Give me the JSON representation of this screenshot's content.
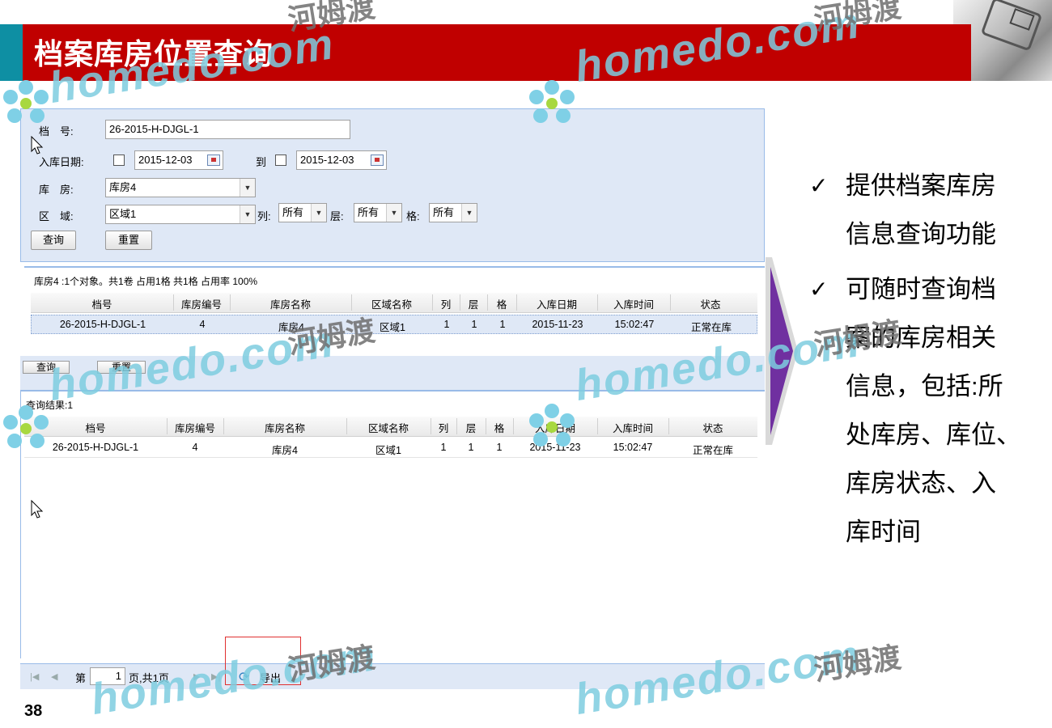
{
  "slide": {
    "title": "档案库房位置查询",
    "page_number": "38"
  },
  "query_form": {
    "archive_no_label": "档　号:",
    "archive_no_value": "26-2015-H-DJGL-1",
    "entry_date_label": "入库日期:",
    "date_from": "2015-12-03",
    "to_label": "到",
    "date_to": "2015-12-03",
    "warehouse_label": "库　房:",
    "warehouse_value": "库房4",
    "area_label": "区　域:",
    "area_value": "区域1",
    "column_label": "列:",
    "column_value": "所有",
    "layer_label": "层:",
    "layer_value": "所有",
    "cell_label": "格:",
    "cell_value": "所有",
    "query_button": "查询",
    "reset_button": "重置"
  },
  "summary": {
    "text": "库房4 :1个对象。共1卷 占用1格 共1格 占用率 100%"
  },
  "grid_columns": [
    "档号",
    "库房编号",
    "库房名称",
    "区域名称",
    "列",
    "层",
    "格",
    "入库日期",
    "入库时间",
    "状态"
  ],
  "grid1_rows": [
    [
      "26-2015-H-DJGL-1",
      "4",
      "库房4",
      "区域1",
      "1",
      "1",
      "1",
      "2015-11-23",
      "15:02:47",
      "正常在库"
    ]
  ],
  "results": {
    "label": "查询结果:1",
    "ghost_query_button": "查询",
    "ghost_reset_button": "重置",
    "rows": [
      [
        "26-2015-H-DJGL-1",
        "4",
        "库房4",
        "区域1",
        "1",
        "1",
        "1",
        "2015-11-23",
        "15:02:47",
        "正常在库"
      ]
    ]
  },
  "pager": {
    "page_prefix": "第",
    "page_value": "1",
    "page_suffix": "页,共1页",
    "export_label": "导出"
  },
  "bullets": {
    "b1_line1": "提供档案库房",
    "b1_line2": "信息查询功能",
    "b2_line1": "可随时查询档",
    "b2_line2": "案的库房相关",
    "b2_line3": "信息，包括:所",
    "b2_line4": "处库房、库位、",
    "b2_line5": "库房状态、入",
    "b2_line6": "库时间"
  },
  "watermark": {
    "site": "homedo.com",
    "brand": "河姆渡"
  },
  "colors": {
    "title_bar": "#c00000",
    "accent": "#0e8fa3",
    "panel_bg": "#dfe8f6",
    "panel_border": "#99bbe8",
    "arrow": "#7030a0"
  }
}
